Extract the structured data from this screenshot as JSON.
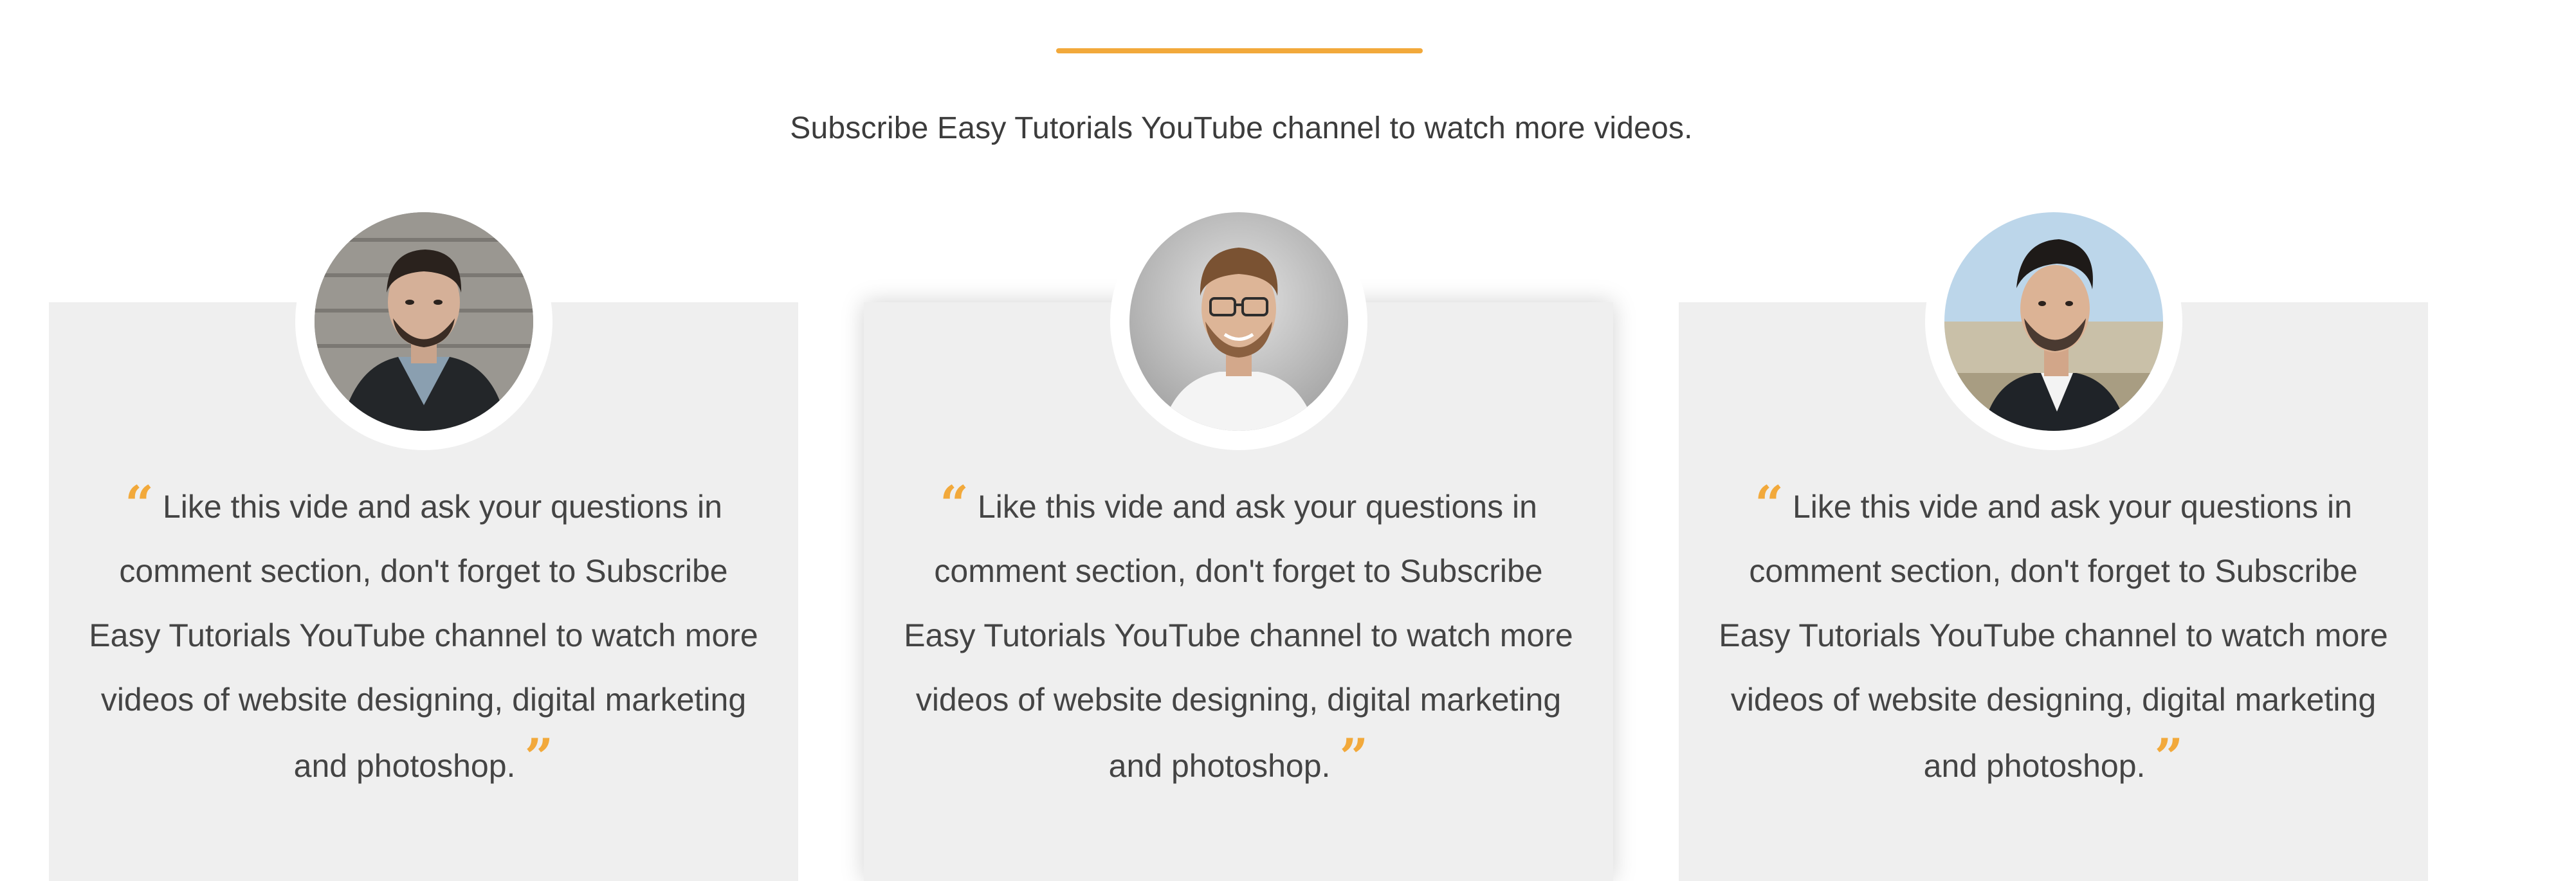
{
  "colors": {
    "accent": "#f2a93b",
    "card_bg": "#efefef",
    "text": "#444444"
  },
  "header": {
    "subtitle": "Subscribe Easy Tutorials YouTube channel to watch more videos."
  },
  "testimonials": [
    {
      "open_quote": "“",
      "lines": [
        "Like this vide and ask your questions in",
        "comment section, don't forget to Subscribe",
        "Easy Tutorials YouTube channel to watch more",
        "videos of website designing, digital marketing",
        "and photoshop."
      ],
      "close_quote": "”"
    },
    {
      "open_quote": "“",
      "lines": [
        "Like this vide and ask your questions in",
        "comment section, don't forget to Subscribe",
        "Easy Tutorials YouTube channel to watch more",
        "videos of website designing, digital marketing",
        "and photoshop."
      ],
      "close_quote": "”"
    },
    {
      "open_quote": "“",
      "lines": [
        "Like this vide and ask your questions in",
        "comment section, don't forget to Subscribe",
        "Easy Tutorials YouTube channel to watch more",
        "videos of website designing, digital marketing",
        "and photoshop."
      ],
      "close_quote": "”"
    }
  ]
}
